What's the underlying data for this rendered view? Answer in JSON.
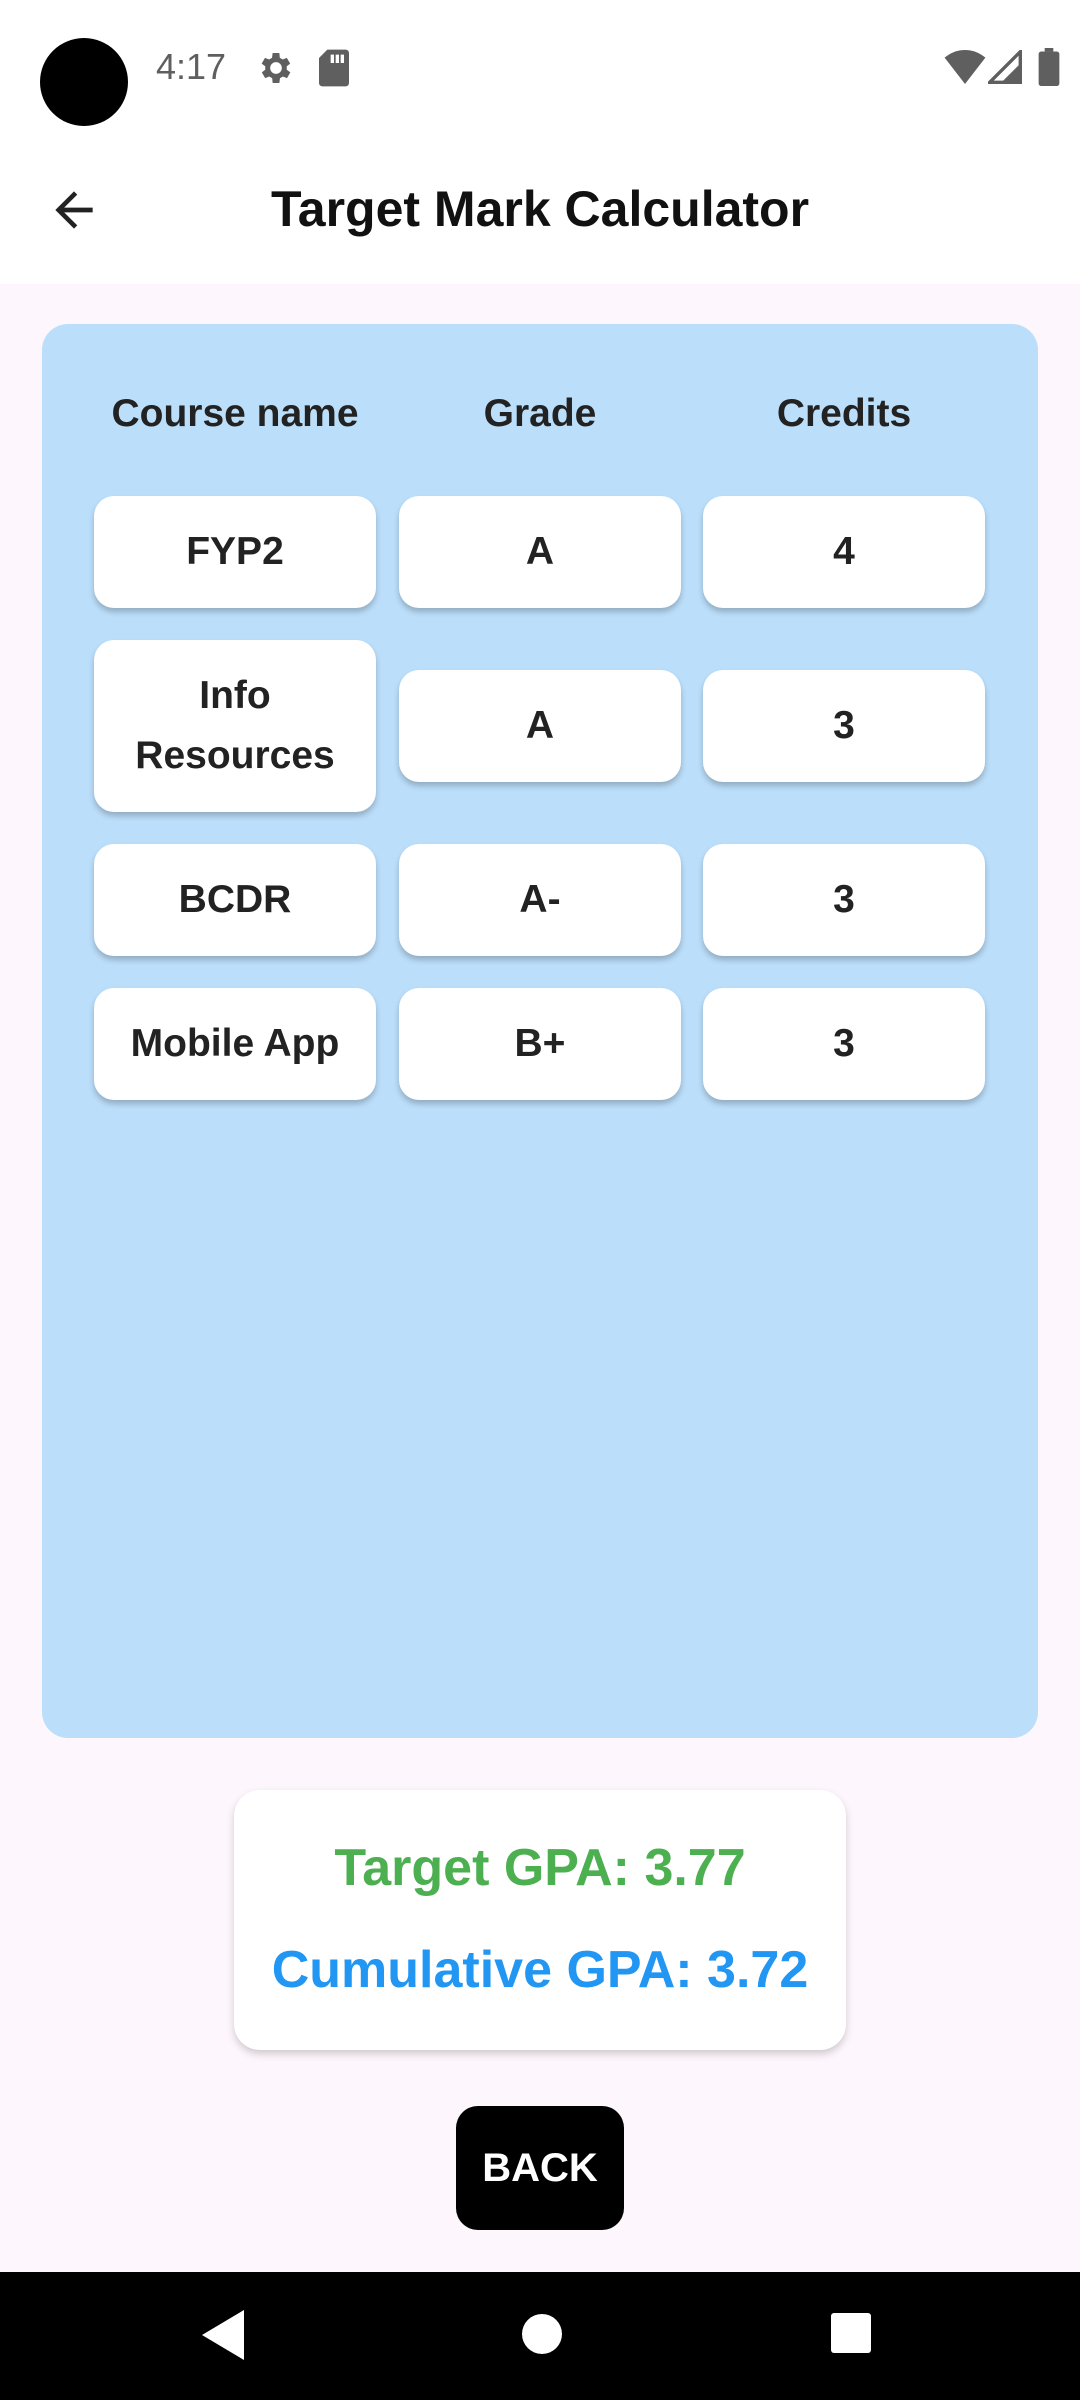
{
  "status_bar": {
    "time": "4:17",
    "icons": [
      "gear-icon",
      "sd-card-icon",
      "wifi-icon",
      "cell-signal-icon",
      "battery-icon"
    ]
  },
  "app_bar": {
    "title": "Target Mark Calculator",
    "back_icon": "arrow-left-icon"
  },
  "table": {
    "headers": [
      "Course name",
      "Grade",
      "Credits"
    ],
    "rows": [
      {
        "course": "FYP2",
        "grade": "A",
        "credits": "4"
      },
      {
        "course": "Info Resources",
        "grade": "A",
        "credits": "3"
      },
      {
        "course": "BCDR",
        "grade": "A-",
        "credits": "3"
      },
      {
        "course": "Mobile App",
        "grade": "B+",
        "credits": "3"
      }
    ]
  },
  "gpa": {
    "target": "Target GPA: 3.77",
    "cumulative": "Cumulative GPA: 3.72"
  },
  "actions": {
    "back_label": "BACK"
  },
  "colors": {
    "card_bg": "#bbdefa",
    "page_bg": "#fdf6fc",
    "target_color": "#4caf50",
    "cumulative_color": "#2196f3",
    "button_bg": "#000000"
  },
  "nav_bar": {
    "icons": [
      "nav-back-icon",
      "nav-home-icon",
      "nav-recents-icon"
    ]
  }
}
